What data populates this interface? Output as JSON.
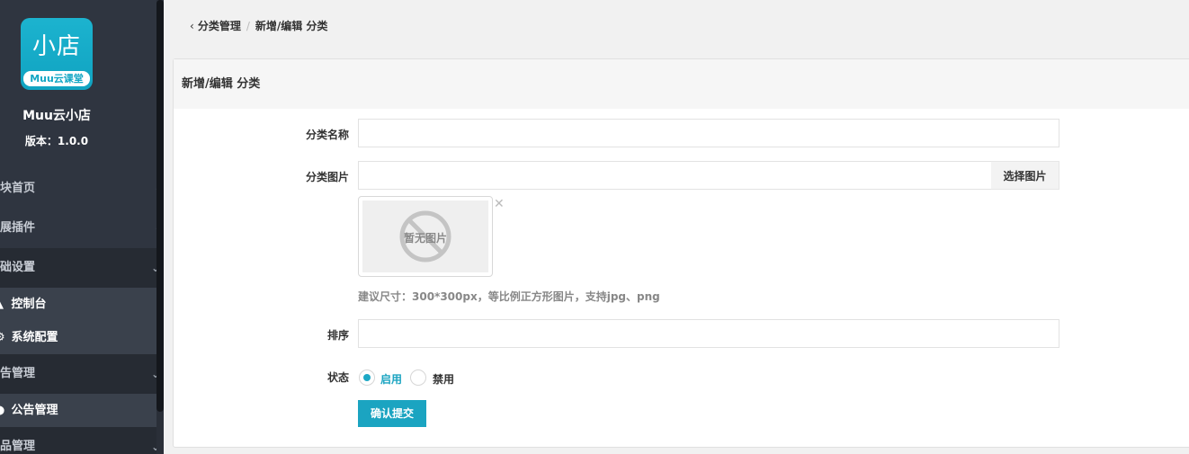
{
  "app": {
    "logo_text": "小店",
    "logo_badge": "Muu云课堂",
    "name": "Muu云小店",
    "version": "版本：1.0.0"
  },
  "sidebar": {
    "groups": [
      {
        "label": "模块首页",
        "chevron": "‹"
      },
      {
        "label": "扩展插件",
        "chevron": "‹"
      },
      {
        "label": "基础设置",
        "chevron": "⌄"
      },
      {
        "label": "公告管理",
        "chevron": "⌄"
      },
      {
        "label": "商品管理",
        "chevron": "⌄"
      }
    ],
    "sub_basic": [
      {
        "label": "控制台",
        "icon": "dashboard-icon",
        "glyph": "▲"
      },
      {
        "label": "系统配置",
        "icon": "gear-icon",
        "glyph": "⚙"
      }
    ],
    "sub_notice": [
      {
        "label": "公告管理",
        "icon": "notice-icon",
        "glyph": "●"
      }
    ]
  },
  "breadcrumb": {
    "back": "‹",
    "parent": "分类管理",
    "separator": "/",
    "current": "新增/编辑 分类"
  },
  "panel": {
    "title": "新增/编辑 分类"
  },
  "form": {
    "name_label": "分类名称",
    "name_value": "",
    "image_label": "分类图片",
    "image_value": "",
    "pick_button": "选择图片",
    "no_image_text": "暂无图片",
    "remove_glyph": "✕",
    "hint": "建议尺寸：300*300px，等比例正方形图片，支持jpg、png",
    "sort_label": "排序",
    "sort_value": "",
    "status_label": "状态",
    "status_options": [
      {
        "label": "启用",
        "checked": true
      },
      {
        "label": "禁用",
        "checked": false
      }
    ],
    "submit": "确认提交"
  },
  "colors": {
    "accent": "#1ba4c1",
    "sidebar_bg": "#2f3540",
    "sidebar_sub_bg": "#3a414c"
  }
}
